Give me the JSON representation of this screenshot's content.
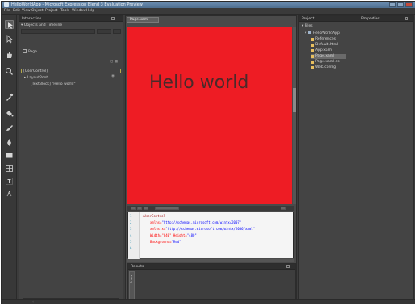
{
  "window": {
    "title": "HelloWorldApp - Microsoft Expression Blend 3 Evaluation Preview"
  },
  "menu": {
    "items": [
      "File",
      "Edit",
      "View",
      "Object",
      "Project",
      "Tools",
      "Window",
      "Help"
    ]
  },
  "objects_panel": {
    "tab_label": "Interaction",
    "section_label": "Objects and Timeline",
    "state_label": "Page",
    "timeline_label": "[UserControl]",
    "root_label": "LayoutRoot",
    "tree_item_label": "[TextBlock] \"Hello world\""
  },
  "document": {
    "tab_label": "Page.xaml",
    "artboard_text": "Hello world",
    "canvas_color": "#ee1c24"
  },
  "xaml": {
    "line_numbers": [
      "1",
      "2",
      "3",
      "4",
      "5",
      "6"
    ],
    "lines": [
      {
        "tag": "<UserControl",
        "attr": "",
        "value": ""
      },
      {
        "tag": "",
        "attr": "xmlns=",
        "value": "\"http://schemas.microsoft.com/winfx/2007\""
      },
      {
        "tag": "",
        "attr": "xmlns:x=",
        "value": "\"http://schemas.microsoft.com/winfx/2006/xaml\""
      },
      {
        "tag": "",
        "attr": "Width=\"640\" Height=",
        "value": "\"480\""
      },
      {
        "tag": "",
        "attr": "Background=",
        "value": "\"Red\""
      },
      {
        "tag": "",
        "attr": "",
        "value": ""
      }
    ]
  },
  "results_panel": {
    "label": "Results",
    "side_tab": "Errors"
  },
  "project_panel": {
    "tab_project": "Project",
    "tab_properties": "Properties",
    "files_label": "Files",
    "root_item": "HelloWorldApp",
    "items": [
      "References",
      "Default.html",
      "App.xaml",
      "Page.xaml",
      "Page.xaml.cs",
      "Web.config"
    ],
    "selected_index": 3
  },
  "tools": {
    "items": [
      "selection-icon",
      "direct-selection-icon",
      "pan-icon",
      "zoom-icon",
      "eyedropper-icon",
      "paint-bucket-icon",
      "brush-icon",
      "pen-icon",
      "rectangle-icon",
      "layout-icon",
      "text-icon",
      "assets-icon"
    ]
  },
  "colors": {
    "chrome": "#3c3c3c",
    "panel": "#444444",
    "accent": "#b5a84a",
    "titlebar": "#5f7fa0"
  }
}
